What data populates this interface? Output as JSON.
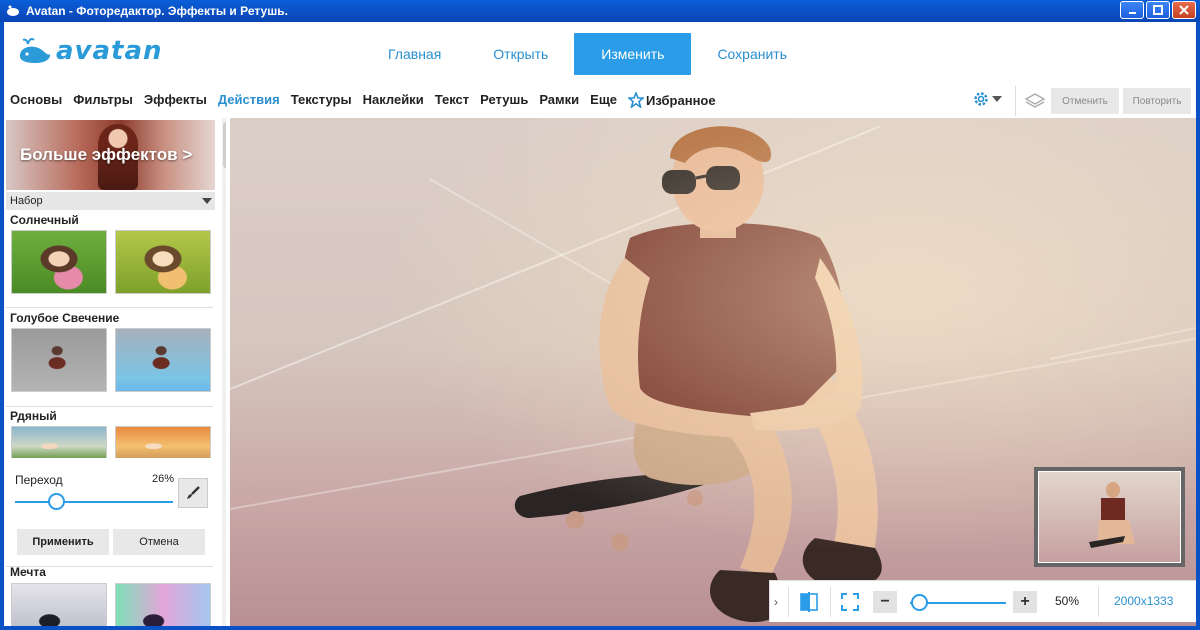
{
  "window": {
    "title": "Avatan - Фоторедактор. Эффекты и Ретушь."
  },
  "logo": {
    "text": "avatan"
  },
  "topnav": [
    "Главная",
    "Открыть",
    "Изменить",
    "Сохранить"
  ],
  "menus": [
    "Основы",
    "Фильтры",
    "Эффекты",
    "Действия",
    "Текстуры",
    "Наклейки",
    "Текст",
    "Ретушь",
    "Рамки",
    "Еще"
  ],
  "favorites_label": "Избранное",
  "undo_label": "Отменить",
  "redo_label": "Повторить",
  "left_panel": {
    "banner": "Больше эффектов >",
    "set_label": "Набор",
    "groups": [
      "Солнечный",
      "Голубое Свечение",
      "Рдяный",
      "Мечта"
    ],
    "slider_label": "Переход",
    "slider_value": "26%",
    "slider_fraction": 0.26,
    "apply": "Применить",
    "cancel": "Отмена"
  },
  "bottom": {
    "zoom": "50%",
    "dimensions": "2000x1333"
  },
  "colors": {
    "accent": "#2a9ce8",
    "titlebar": "#0b51c6"
  }
}
